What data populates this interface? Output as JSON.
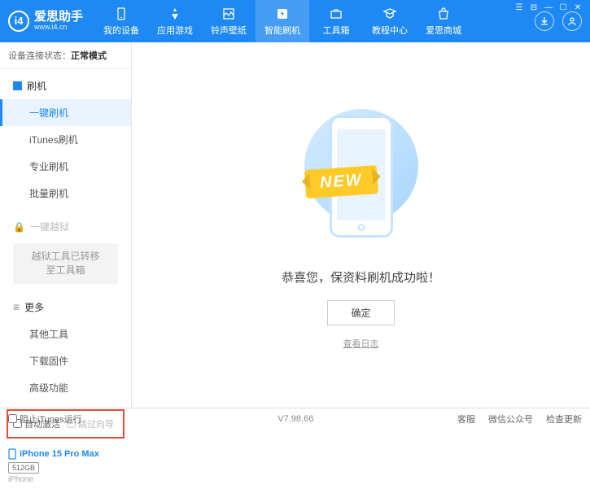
{
  "app": {
    "title": "爱思助手",
    "subtitle": "www.i4.cn",
    "logo_letter": "i4"
  },
  "nav": {
    "items": [
      {
        "label": "我的设备"
      },
      {
        "label": "应用游戏"
      },
      {
        "label": "铃声壁纸"
      },
      {
        "label": "智能刷机"
      },
      {
        "label": "工具箱"
      },
      {
        "label": "教程中心"
      },
      {
        "label": "爱思商城"
      }
    ],
    "active_index": 3
  },
  "status": {
    "prefix": "设备连接状态：",
    "value": "正常模式"
  },
  "sidebar": {
    "heading_flash": "刷机",
    "flash_items": [
      {
        "label": "一键刷机"
      },
      {
        "label": "iTunes刷机"
      },
      {
        "label": "专业刷机"
      },
      {
        "label": "批量刷机"
      }
    ],
    "heading_jailbreak": "一键越狱",
    "jailbreak_notice": "越狱工具已转移至工具箱",
    "heading_more": "更多",
    "more_items": [
      {
        "label": "其他工具"
      },
      {
        "label": "下载固件"
      },
      {
        "label": "高级功能"
      }
    ],
    "checkbox1": "自动激活",
    "checkbox2": "跳过向导"
  },
  "device": {
    "name": "iPhone 15 Pro Max",
    "storage": "512GB",
    "type": "iPhone"
  },
  "main": {
    "ribbon": "NEW",
    "success_text": "恭喜您，保资料刷机成功啦！",
    "ok_button": "确定",
    "log_link": "查看日志"
  },
  "footer": {
    "block_itunes": "阻止iTunes运行",
    "version": "V7.98.66",
    "links": [
      "客服",
      "微信公众号",
      "检查更新"
    ]
  }
}
